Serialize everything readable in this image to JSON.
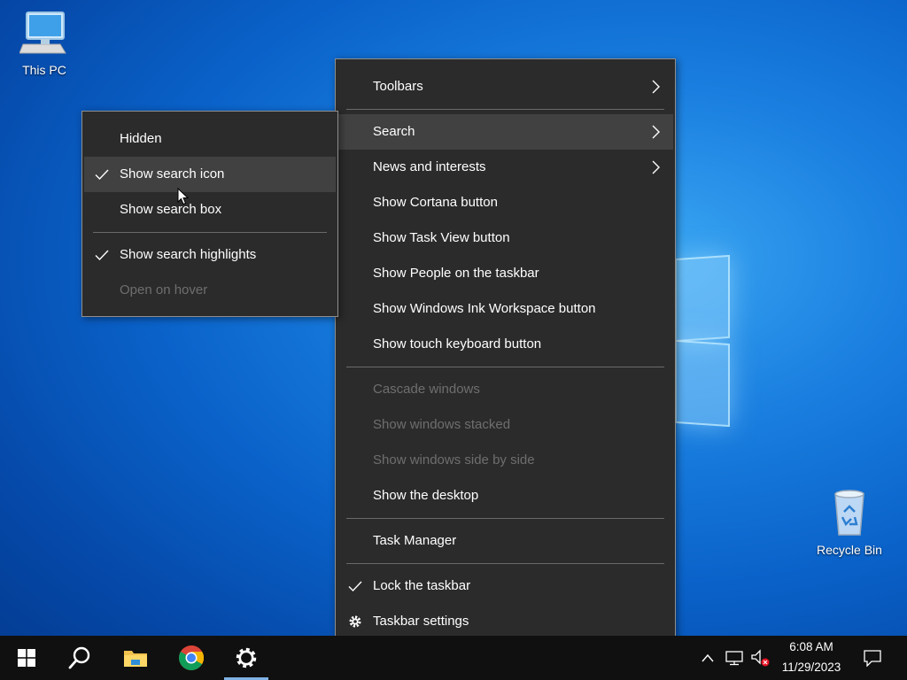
{
  "desktop": {
    "icons": [
      {
        "label": "This PC"
      },
      {
        "label": "Recycle Bin"
      }
    ]
  },
  "main_menu": {
    "items": {
      "toolbars": "Toolbars",
      "search": "Search",
      "news": "News and interests",
      "cortana": "Show Cortana button",
      "task_view": "Show Task View button",
      "people": "Show People on the taskbar",
      "ink": "Show Windows Ink Workspace button",
      "touch_keyboard": "Show touch keyboard button",
      "cascade": "Cascade windows",
      "stacked": "Show windows stacked",
      "side_by_side": "Show windows side by side",
      "show_desktop": "Show the desktop",
      "task_manager": "Task Manager",
      "lock": "Lock the taskbar",
      "settings": "Taskbar settings"
    }
  },
  "search_submenu": {
    "items": {
      "hidden": "Hidden",
      "search_icon": "Show search icon",
      "search_box": "Show search box",
      "highlights": "Show search highlights",
      "open_on_hover": "Open on hover"
    }
  },
  "taskbar": {
    "clock_time": "6:08 AM",
    "clock_date": "11/29/2023",
    "apps": [
      "start-icon",
      "search-icon",
      "file-explorer-icon",
      "chrome-icon",
      "settings-icon"
    ]
  },
  "colors": {
    "menu_bg": "#2b2b2b",
    "menu_hover": "#414141",
    "disabled_text": "#6e6e6e",
    "taskbar_bg": "#101010",
    "active_indicator": "#7fb2e5"
  }
}
